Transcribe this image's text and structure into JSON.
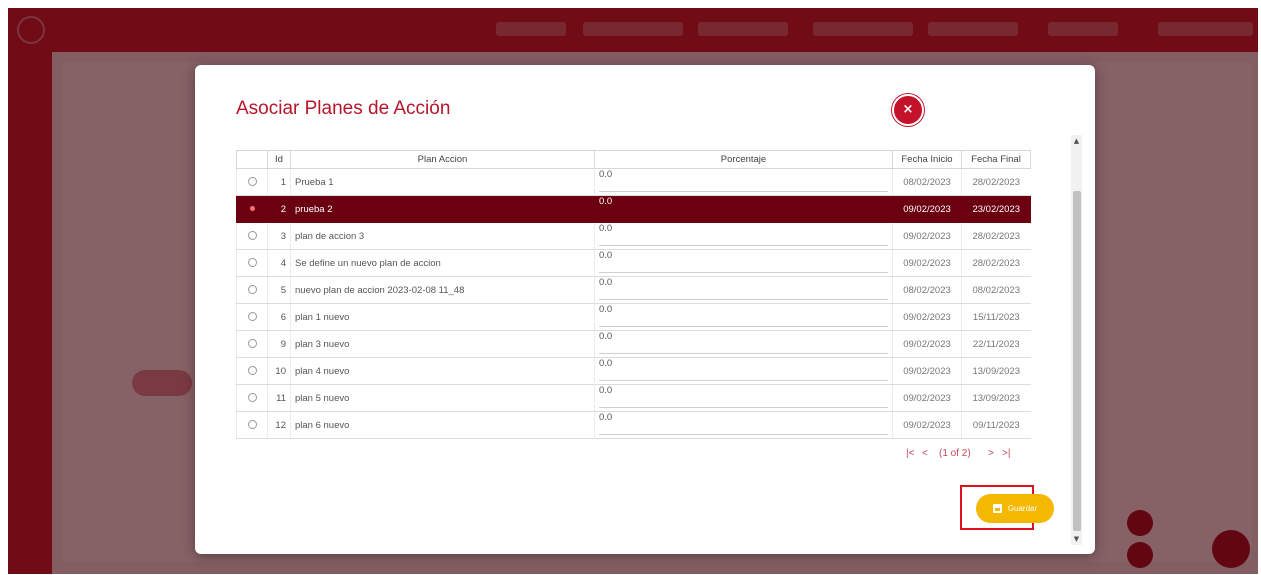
{
  "modal": {
    "title": "Asociar Planes de Acción",
    "close_label": "×",
    "columns": [
      "",
      "Id",
      "Plan Accion",
      "Porcentaje",
      "Fecha Inicio",
      "Fecha Final"
    ],
    "rows": [
      {
        "id": "1",
        "plan": "Prueba 1",
        "pct": "0.0",
        "start": "08/02/2023",
        "end": "28/02/2023",
        "selected": false
      },
      {
        "id": "2",
        "plan": "prueba 2",
        "pct": "0.0",
        "start": "09/02/2023",
        "end": "23/02/2023",
        "selected": true
      },
      {
        "id": "3",
        "plan": "plan de accion 3",
        "pct": "0.0",
        "start": "09/02/2023",
        "end": "28/02/2023",
        "selected": false
      },
      {
        "id": "4",
        "plan": "Se define un nuevo plan de accion",
        "pct": "0.0",
        "start": "09/02/2023",
        "end": "28/02/2023",
        "selected": false
      },
      {
        "id": "5",
        "plan": "nuevo plan de accion 2023-02-08 11_48",
        "pct": "0.0",
        "start": "08/02/2023",
        "end": "08/02/2023",
        "selected": false
      },
      {
        "id": "6",
        "plan": "plan 1 nuevo",
        "pct": "0.0",
        "start": "09/02/2023",
        "end": "15/11/2023",
        "selected": false
      },
      {
        "id": "9",
        "plan": "plan 3 nuevo",
        "pct": "0.0",
        "start": "09/02/2023",
        "end": "22/11/2023",
        "selected": false
      },
      {
        "id": "10",
        "plan": "plan 4 nuevo",
        "pct": "0.0",
        "start": "09/02/2023",
        "end": "13/09/2023",
        "selected": false
      },
      {
        "id": "11",
        "plan": "plan 5 nuevo",
        "pct": "0.0",
        "start": "09/02/2023",
        "end": "13/09/2023",
        "selected": false
      },
      {
        "id": "12",
        "plan": "plan 6 nuevo",
        "pct": "0.0",
        "start": "09/02/2023",
        "end": "09/11/2023",
        "selected": false
      }
    ],
    "pager": {
      "first": "|<",
      "prev": "<",
      "report": "(1 of 2)",
      "next": ">",
      "last": ">|"
    },
    "save_label": "Guardar"
  },
  "colors": {
    "brand": "#c71d2c",
    "selected_row": "#6b0010",
    "save_button": "#f5b800",
    "highlight": "#e01020"
  }
}
